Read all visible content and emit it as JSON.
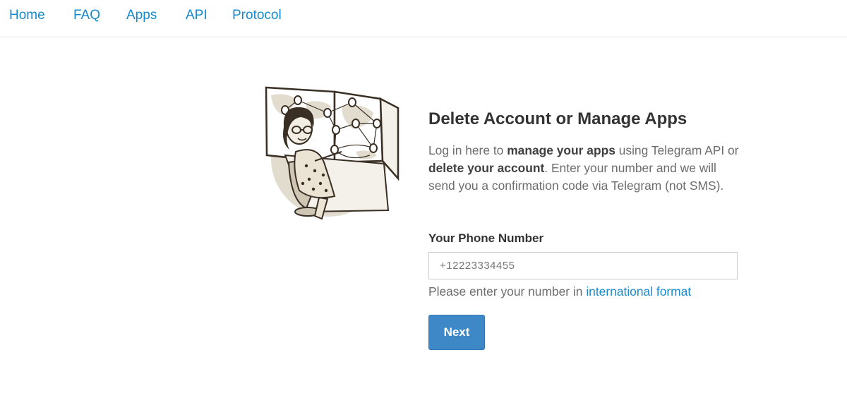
{
  "nav": {
    "items": [
      {
        "label": "Home"
      },
      {
        "label": "FAQ"
      },
      {
        "label": "Apps"
      },
      {
        "label": "API"
      },
      {
        "label": "Protocol"
      }
    ]
  },
  "main": {
    "title": "Delete Account or Manage Apps",
    "description": {
      "part1": "Log in here to ",
      "bold1": "manage your apps",
      "part2": " using Telegram API or ",
      "bold2": "delete your account",
      "part3": ". Enter your number and we will send you a confirmation code via Telegram (not SMS)."
    },
    "phone_label": "Your Phone Number",
    "phone_placeholder": "+12223334455",
    "hint_text": "Please enter your number in ",
    "hint_link": "international format",
    "next_label": "Next"
  },
  "colors": {
    "link": "#168acd",
    "button": "#3e88c8"
  }
}
